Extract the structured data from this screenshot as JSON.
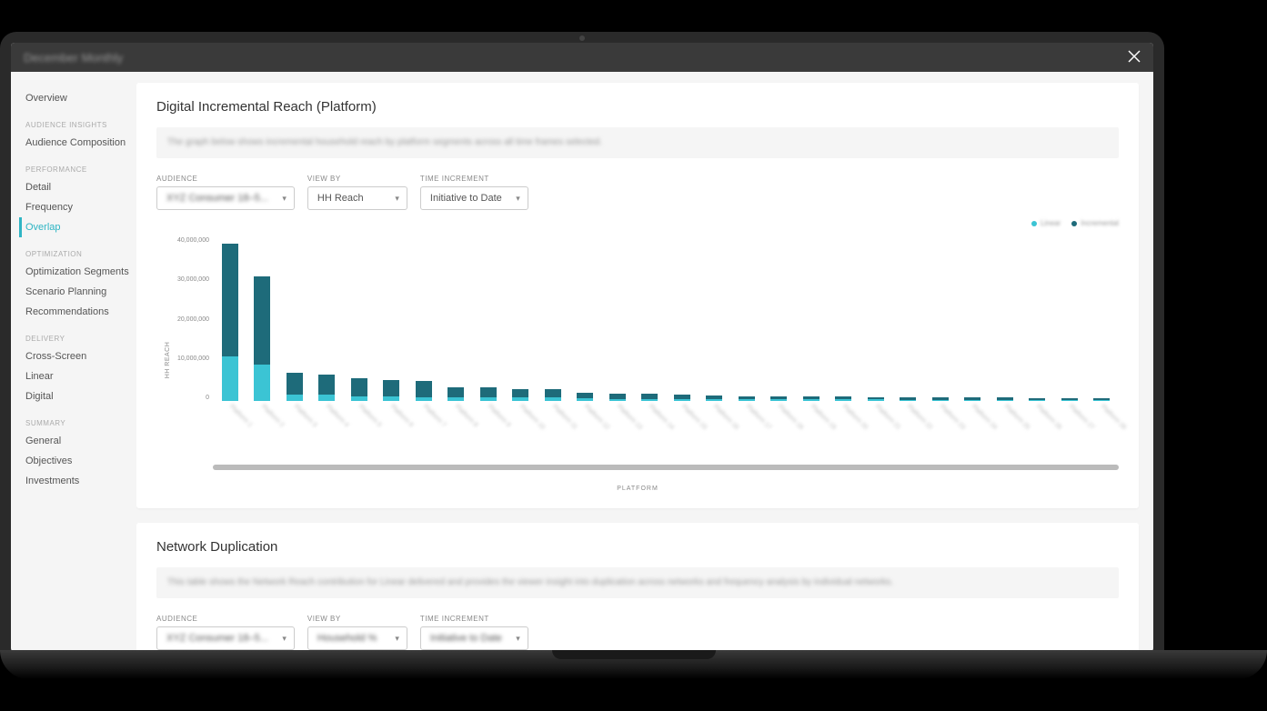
{
  "window": {
    "title": "December Monthly"
  },
  "sidebar": {
    "overview": "Overview",
    "sections": [
      {
        "header": "AUDIENCE INSIGHTS",
        "items": [
          "Audience Composition"
        ]
      },
      {
        "header": "PERFORMANCE",
        "items": [
          "Detail",
          "Frequency",
          "Overlap"
        ],
        "active": "Overlap"
      },
      {
        "header": "OPTIMIZATION",
        "items": [
          "Optimization Segments",
          "Scenario Planning",
          "Recommendations"
        ]
      },
      {
        "header": "DELIVERY",
        "items": [
          "Cross-Screen",
          "Linear",
          "Digital"
        ]
      },
      {
        "header": "SUMMARY",
        "items": [
          "General",
          "Objectives",
          "Investments"
        ]
      }
    ]
  },
  "panel1": {
    "title": "Digital Incremental Reach (Platform)",
    "description": "The graph below shows incremental household reach by platform segments across all time frames selected.",
    "controls": {
      "audience": {
        "label": "AUDIENCE",
        "value": "XYZ Consumer 18–5..."
      },
      "viewby": {
        "label": "VIEW BY",
        "value": "HH Reach"
      },
      "timeinc": {
        "label": "TIME INCREMENT",
        "value": "Initiative to Date"
      }
    },
    "legend": {
      "a": "Linear",
      "a_color": "#3bc4d4",
      "b": "Incremental",
      "b_color": "#1e6b7a"
    },
    "yaxis": {
      "label": "HH REACH",
      "ticks": [
        "40,000,000",
        "30,000,000",
        "20,000,000",
        "10,000,000",
        "0"
      ]
    },
    "xaxis": {
      "label": "PLATFORM"
    }
  },
  "panel2": {
    "title": "Network Duplication",
    "description": "This table shows the Network Reach contribution for Linear delivered and provides the viewer insight into duplication across networks and frequency analysis by individual networks.",
    "controls": {
      "audience": {
        "label": "AUDIENCE",
        "value": "XYZ Consumer 18–5..."
      },
      "viewby": {
        "label": "VIEW BY",
        "value": "Household %"
      },
      "timeinc": {
        "label": "TIME INCREMENT",
        "value": "Initiative to Date"
      }
    }
  },
  "chart_data": {
    "type": "bar",
    "stacked": true,
    "ylabel": "HH REACH",
    "xlabel": "PLATFORM",
    "ylim": [
      0,
      40000000
    ],
    "categories": [
      "Platform 1",
      "Platform 2",
      "Platform 3",
      "Platform 4",
      "Platform 5",
      "Platform 6",
      "Platform 7",
      "Platform 8",
      "Platform 9",
      "Platform 10",
      "Platform 11",
      "Platform 12",
      "Platform 13",
      "Platform 14",
      "Platform 15",
      "Platform 16",
      "Platform 17",
      "Platform 18",
      "Platform 19",
      "Platform 20",
      "Platform 21",
      "Platform 22",
      "Platform 23",
      "Platform 24",
      "Platform 25",
      "Platform 26",
      "Platform 27",
      "Platform 28"
    ],
    "series": [
      {
        "name": "Linear",
        "color": "#3bc4d4",
        "values": [
          11000000,
          9000000,
          1500000,
          1500000,
          1200000,
          1200000,
          1000000,
          900000,
          900000,
          800000,
          800000,
          600000,
          500000,
          500000,
          500000,
          400000,
          400000,
          400000,
          400000,
          400000,
          400000,
          300000,
          300000,
          300000,
          300000,
          300000,
          300000,
          300000
        ]
      },
      {
        "name": "Incremental",
        "color": "#1e6b7a",
        "values": [
          27500000,
          21500000,
          5500000,
          5000000,
          4300000,
          4000000,
          3800000,
          2500000,
          2500000,
          2200000,
          2100000,
          1400000,
          1200000,
          1200000,
          1000000,
          1000000,
          800000,
          800000,
          700000,
          700000,
          600000,
          500000,
          500000,
          500000,
          500000,
          400000,
          400000,
          400000
        ]
      }
    ]
  }
}
